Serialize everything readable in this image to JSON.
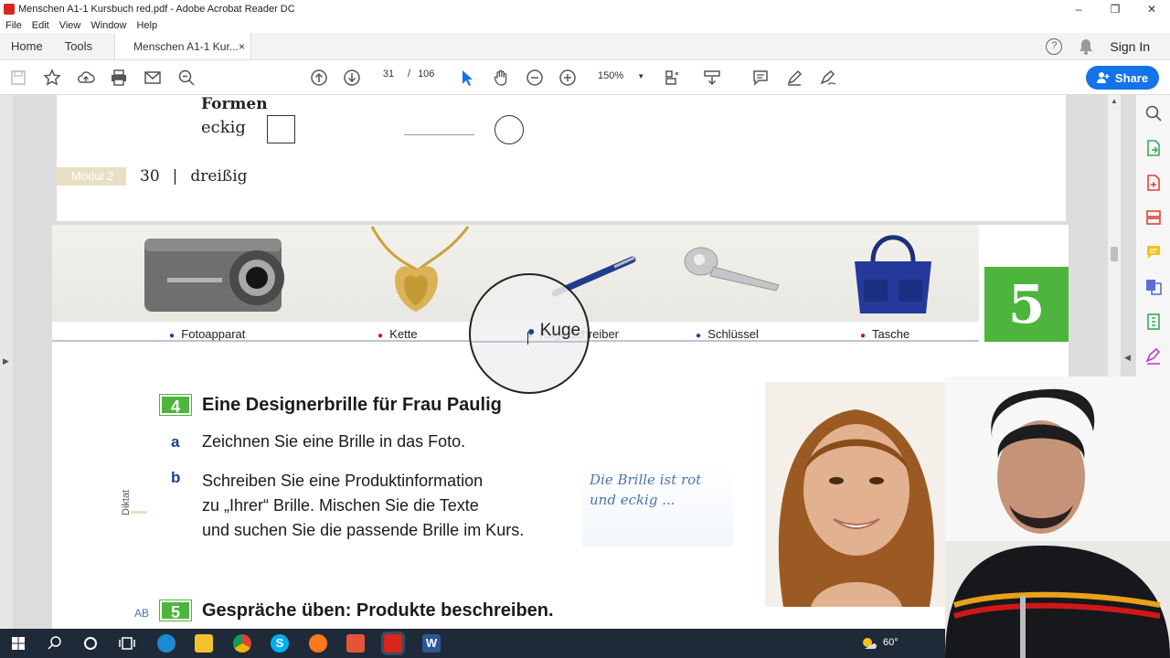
{
  "window": {
    "title": "Menschen A1-1 Kursbuch red.pdf - Adobe Acrobat Reader DC",
    "controls": [
      "–",
      "❐",
      "✕"
    ]
  },
  "menu": [
    "File",
    "Edit",
    "View",
    "Window",
    "Help"
  ],
  "tabs": {
    "home": "Home",
    "tools": "Tools",
    "doc": "Menschen A1-1 Kur...",
    "close": "×",
    "help": "?",
    "sign_in": "Sign In"
  },
  "toolbar": {
    "page_current": "31",
    "page_sep": "/",
    "page_total": "106",
    "zoom": "150%",
    "share": "Share"
  },
  "pdf": {
    "page30": {
      "heading": "Formen",
      "eckig": "eckig",
      "module": "Modul 2",
      "page_no": "30",
      "sep": "|",
      "page_word": "dreißig"
    },
    "page31": {
      "items": [
        "Fotoapparat",
        "Kette",
        "Kugelschreiber",
        "Schlüssel",
        "Tasche"
      ],
      "magnified_text": "Kuge",
      "tab_number": "5",
      "ex4_num": "4",
      "ex4_title": "Eine Designerbrille für Frau Paulig",
      "a": "a",
      "a_text": "Zeichnen Sie eine Brille in das Foto.",
      "b": "b",
      "b_line1": "Schreiben Sie eine Produktinformation",
      "b_line2": "zu „Ihrer“ Brille. Mischen Sie die Texte",
      "b_line3": "und suchen Sie die passende Brille im Kurs.",
      "diktat": "Diktat",
      "hand_line1": "Die Brille ist rot",
      "hand_line2": "und eckig ...",
      "ab": "AB",
      "ex5_num": "5",
      "ex5_title": "Gespräche üben: Produkte beschreiben."
    }
  },
  "taskbar": {
    "temp": "60°"
  },
  "colors": {
    "accent": "#1473e6",
    "green": "#4db53c",
    "module_bar": "#e9dfc3",
    "red_dot": "#d0151b",
    "blue_dot": "#1a3f8f"
  }
}
